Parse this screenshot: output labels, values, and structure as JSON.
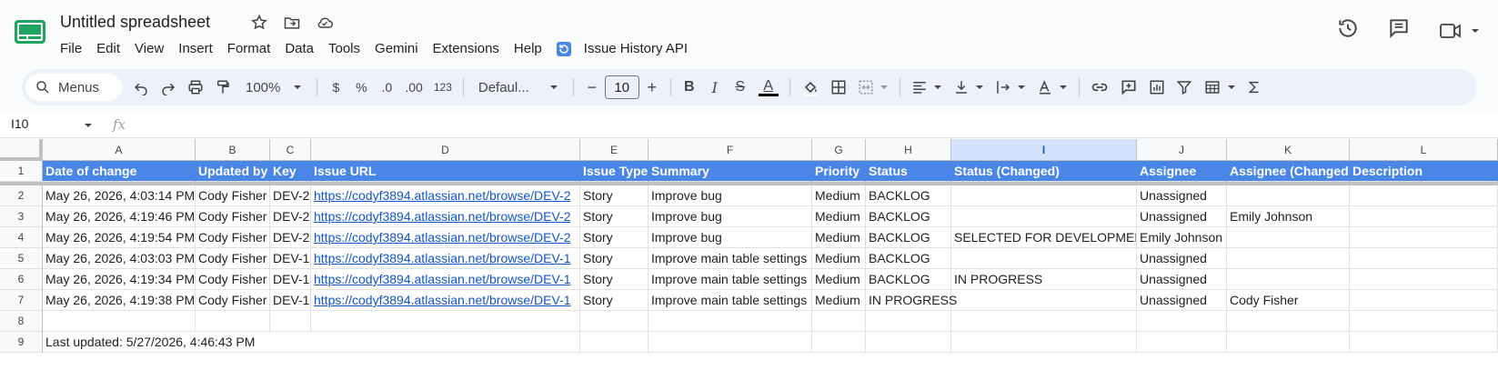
{
  "app": {
    "doc_title": "Untitled spreadsheet",
    "menus": [
      "File",
      "Edit",
      "View",
      "Insert",
      "Format",
      "Data",
      "Tools",
      "Gemini",
      "Extensions",
      "Help"
    ],
    "extension_label": "Issue History API"
  },
  "toolbar": {
    "search_label": "Menus",
    "zoom": "100%",
    "currency": "$",
    "percent": "%",
    "dec_decrease": ".0",
    "dec_increase": ".00",
    "number_format": "123",
    "font": "Defaul...",
    "font_size": "10",
    "minus": "−",
    "plus": "+",
    "bold": "B",
    "italic": "I",
    "strike": "S",
    "text_color": "A"
  },
  "formula_bar": {
    "cell_ref": "I10",
    "fx": "fx"
  },
  "sheet": {
    "columns": [
      "A",
      "B",
      "C",
      "D",
      "E",
      "F",
      "G",
      "H",
      "I",
      "J",
      "K",
      "L"
    ],
    "selected_column": "I",
    "row_numbers": [
      "1",
      "2",
      "3",
      "4",
      "5",
      "6",
      "7",
      "8",
      "9"
    ],
    "headers": [
      "Date of change",
      "Updated by",
      "Key",
      "Issue URL",
      "Issue Type",
      "Summary",
      "Priority",
      "Status",
      "Status (Changed)",
      "Assignee",
      "Assignee (Changed)",
      "Description"
    ],
    "rows": [
      [
        "May 26, 2026, 4:03:14 PM",
        "Cody Fisher",
        "DEV-2",
        "https://codyf3894.atlassian.net/browse/DEV-2",
        "Story",
        "Improve bug",
        "Medium",
        "BACKLOG",
        "",
        "Unassigned",
        "",
        ""
      ],
      [
        "May 26, 2026, 4:19:46 PM",
        "Cody Fisher",
        "DEV-2",
        "https://codyf3894.atlassian.net/browse/DEV-2",
        "Story",
        "Improve bug",
        "Medium",
        "BACKLOG",
        "",
        "Unassigned",
        "Emily Johnson",
        ""
      ],
      [
        "May 26, 2026, 4:19:54 PM",
        "Cody Fisher",
        "DEV-2",
        "https://codyf3894.atlassian.net/browse/DEV-2",
        "Story",
        "Improve bug",
        "Medium",
        "BACKLOG",
        "SELECTED FOR DEVELOPMENT",
        "Emily Johnson",
        "",
        ""
      ],
      [
        "May 26, 2026, 4:03:03 PM",
        "Cody Fisher",
        "DEV-1",
        "https://codyf3894.atlassian.net/browse/DEV-1",
        "Story",
        "Improve main table settings",
        "Medium",
        "BACKLOG",
        "",
        "Unassigned",
        "",
        ""
      ],
      [
        "May 26, 2026, 4:19:34 PM",
        "Cody Fisher",
        "DEV-1",
        "https://codyf3894.atlassian.net/browse/DEV-1",
        "Story",
        "Improve main table settings",
        "Medium",
        "BACKLOG",
        "IN PROGRESS",
        "Unassigned",
        "",
        ""
      ],
      [
        "May 26, 2026, 4:19:38 PM",
        "Cody Fisher",
        "DEV-1",
        "https://codyf3894.atlassian.net/browse/DEV-1",
        "Story",
        "Improve main table settings",
        "Medium",
        "IN PROGRESS",
        "",
        "Unassigned",
        "Cody Fisher",
        ""
      ]
    ],
    "footer_note": "Last updated: 5/27/2026, 4:46:43 PM"
  },
  "colors": {
    "header_bg": "#4a86e8",
    "link": "#1155cc",
    "selected_col": "#d3e3fd"
  }
}
